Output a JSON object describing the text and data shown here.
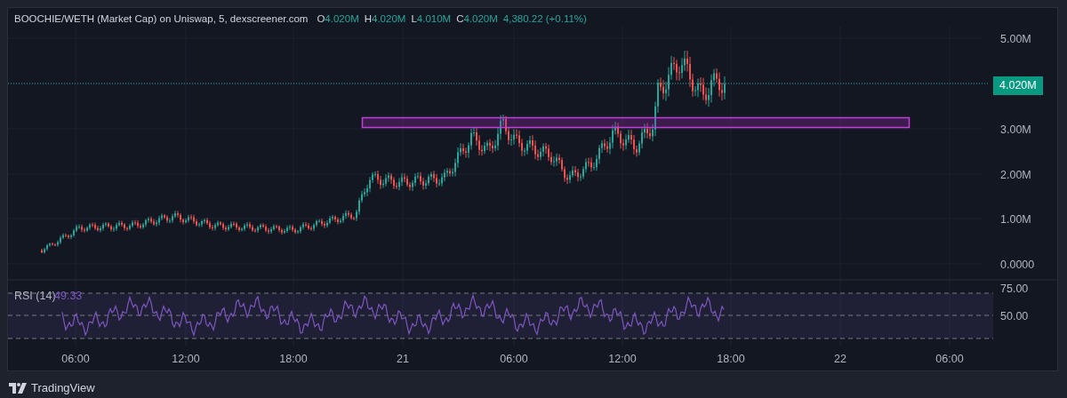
{
  "header": {
    "title": "BOOCHIE/WETH (Market Cap) on Uniswap, 5, dexscreener.com",
    "ohlc": [
      {
        "label": "O",
        "value": "4.020M"
      },
      {
        "label": "H",
        "value": "4.020M"
      },
      {
        "label": "L",
        "value": "4.010M"
      },
      {
        "label": "C",
        "value": "4.020M"
      }
    ],
    "change": "4,380.22 (+0.11%)"
  },
  "price_axis": [
    "5.00M",
    "3.00M",
    "2.00M",
    "1.00M",
    "0.0000"
  ],
  "current_price": "4.020M",
  "rsi": {
    "label": "RSI (14)",
    "value": "49.33",
    "axis": [
      "75.00",
      "50.00"
    ]
  },
  "time_axis": [
    "06:00",
    "12:00",
    "18:00",
    "21",
    "06:00",
    "12:00",
    "18:00",
    "22",
    "06:00"
  ],
  "footer": {
    "brand": "TradingView"
  }
}
